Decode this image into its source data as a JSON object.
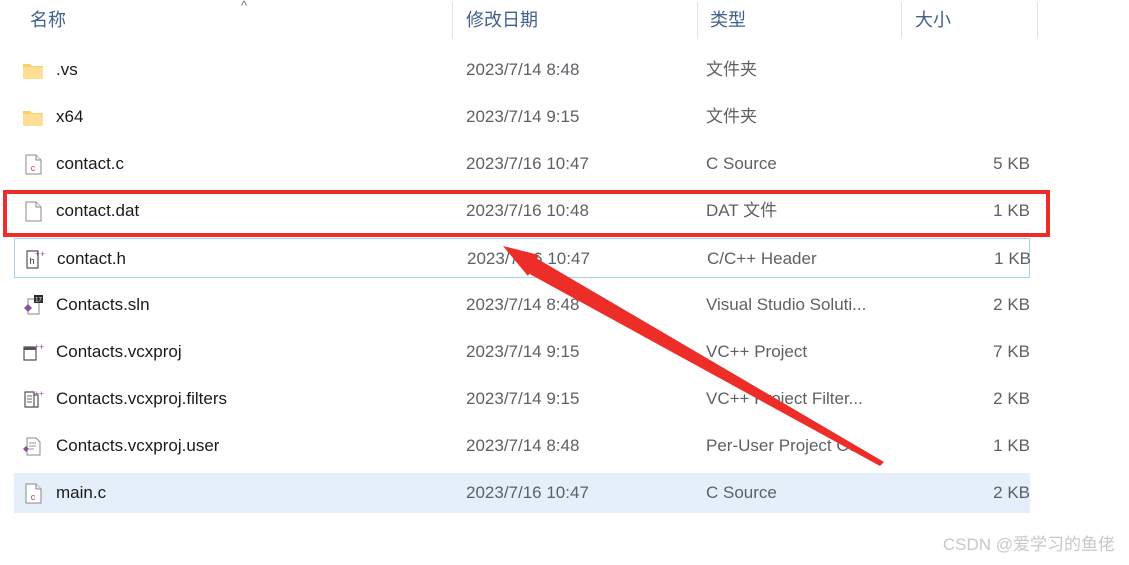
{
  "window": {
    "kind": "file-explorer-list"
  },
  "columns": {
    "headers": [
      {
        "key": "name",
        "label": "名称"
      },
      {
        "key": "date",
        "label": "修改日期"
      },
      {
        "key": "type",
        "label": "类型"
      },
      {
        "key": "size",
        "label": "大小"
      }
    ],
    "sort": {
      "column": "name",
      "direction": "ascending",
      "glyph": "^"
    }
  },
  "files": [
    {
      "name": ".vs",
      "date": "2023/7/14 8:48",
      "type": "文件夹",
      "size": "",
      "icon": "folder-icon",
      "state": "normal"
    },
    {
      "name": "x64",
      "date": "2023/7/14 9:15",
      "type": "文件夹",
      "size": "",
      "icon": "folder-icon",
      "state": "normal"
    },
    {
      "name": "contact.c",
      "date": "2023/7/16 10:47",
      "type": "C Source",
      "size": "5 KB",
      "icon": "c-source-file-icon",
      "state": "normal"
    },
    {
      "name": "contact.dat",
      "date": "2023/7/16 10:48",
      "type": "DAT 文件",
      "size": "1 KB",
      "icon": "blank-file-icon",
      "state": "normal"
    },
    {
      "name": "contact.h",
      "date": "2023/7/16 10:47",
      "type": "C/C++ Header",
      "size": "1 KB",
      "icon": "cpp-header-file-icon",
      "state": "hovered"
    },
    {
      "name": "Contacts.sln",
      "date": "2023/7/14 8:48",
      "type": "Visual Studio Soluti...",
      "size": "2 KB",
      "icon": "visual-studio-solution-icon",
      "state": "normal"
    },
    {
      "name": "Contacts.vcxproj",
      "date": "2023/7/14 9:15",
      "type": "VC++ Project",
      "size": "7 KB",
      "icon": "vcxproj-file-icon",
      "state": "normal"
    },
    {
      "name": "Contacts.vcxproj.filters",
      "date": "2023/7/14 9:15",
      "type": "VC++ Project Filter...",
      "size": "2 KB",
      "icon": "vcxproj-filters-file-icon",
      "state": "normal"
    },
    {
      "name": "Contacts.vcxproj.user",
      "date": "2023/7/14 8:48",
      "type": "Per-User Project O...",
      "size": "1 KB",
      "icon": "vcxproj-user-file-icon",
      "state": "normal"
    },
    {
      "name": "main.c",
      "date": "2023/7/16 10:47",
      "type": "C Source",
      "size": "2 KB",
      "icon": "c-source-file-icon",
      "state": "selected"
    }
  ],
  "annotations": {
    "highlight_box": {
      "target": "contact.dat",
      "color": "#ec2d28"
    },
    "arrow": {
      "points_to": "contact.h",
      "color": "#ec2d28"
    }
  },
  "watermark": {
    "text": "CSDN @爱学习的鱼佬"
  },
  "colors": {
    "header_text": "#41618c",
    "selection_fill": "#e4eff9",
    "hover_border": "#a5d0ee",
    "annotation_red": "#ec2d28",
    "folder_yellow": "#fbd277",
    "vs_purple": "#8e4f9e"
  }
}
